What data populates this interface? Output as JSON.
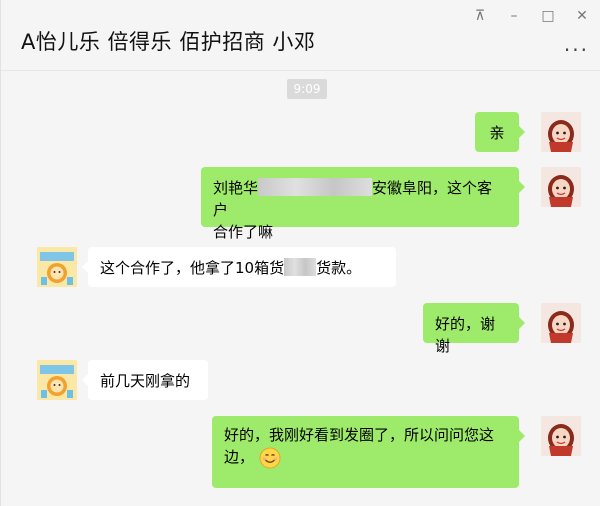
{
  "window": {
    "title": "A怡儿乐 倍得乐 佰护招商 小邓",
    "controls": {
      "pin": "⊼",
      "minimize": "–",
      "maximize": "□",
      "close": "✕"
    },
    "more": "···"
  },
  "chat": {
    "timestamp": "9:09",
    "messages": [
      {
        "from": "me",
        "text": "亲"
      },
      {
        "from": "me",
        "part1": "刘艳华",
        "part2": "安徽阜阳，这个客户",
        "line2": "合作了嘛"
      },
      {
        "from": "other",
        "part1": "这个合作了，他拿了10箱货",
        "part2": "货款。"
      },
      {
        "from": "me",
        "text": "好的，谢谢"
      },
      {
        "from": "other",
        "text": "前几天刚拿的"
      },
      {
        "from": "me",
        "line1": "好的，我刚好看到发圈了，所以问问您这",
        "line2": "边，",
        "emoji": "smile-emoji"
      }
    ]
  },
  "colors": {
    "my_bubble": "#9eea6a",
    "other_bubble": "#ffffff",
    "background": "#f5f5f5",
    "timestamp_bg": "#dadada"
  }
}
